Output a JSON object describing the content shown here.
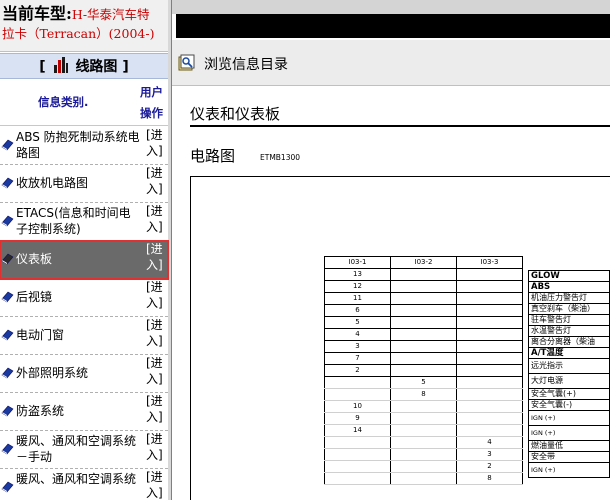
{
  "left_pane": {
    "car_label": "当前车型:",
    "car_model_line1": "H-华泰汽车特",
    "car_model_line2": "拉卡（Terracan）(2004-)",
    "section_title": "线路图",
    "section_bracket_open": "[",
    "section_bracket_close": "]",
    "col_category": "信息类别.",
    "col_ops_line1": "用户",
    "col_ops_line2": "操作",
    "enter_line1": "[进",
    "enter_line2": "入]",
    "items": [
      {
        "name": "ABS 防抱死制动系统电路图",
        "selected": false
      },
      {
        "name": "收放机电路图",
        "selected": false
      },
      {
        "name": "ETACS(信息和时间电子控制系统)",
        "selected": false
      },
      {
        "name": "仪表板",
        "selected": true
      },
      {
        "name": "后视镜",
        "selected": false
      },
      {
        "name": "电动门窗",
        "selected": false
      },
      {
        "name": "外部照明系统",
        "selected": false
      },
      {
        "name": "防盗系统",
        "selected": false
      },
      {
        "name": "暖风、通风和空调系统－手动",
        "selected": false
      },
      {
        "name": "暖风、通风和空调系统",
        "selected": false
      }
    ]
  },
  "right_pane": {
    "toolbar_label": "浏览信息目录",
    "doc_title": "仪表和仪表板",
    "diagram_title": "电路图",
    "diagram_code": "ETMB1300",
    "connectors": {
      "headers": [
        "I03-1",
        "I03-2",
        "I03-3"
      ],
      "rows": [
        [
          "13",
          "",
          ""
        ],
        [
          "12",
          "",
          ""
        ],
        [
          "11",
          "",
          ""
        ],
        [
          "6",
          "",
          ""
        ],
        [
          "5",
          "",
          ""
        ],
        [
          "4",
          "",
          ""
        ],
        [
          "3",
          "",
          ""
        ],
        [
          "7",
          "",
          ""
        ],
        [
          "2",
          "",
          ""
        ],
        [
          "",
          "5",
          ""
        ],
        [
          "",
          "8",
          ""
        ],
        [
          "10",
          "",
          ""
        ],
        [
          "9",
          "",
          ""
        ],
        [
          "14",
          "",
          ""
        ],
        [
          "",
          "",
          "4"
        ],
        [
          "",
          "",
          "3"
        ],
        [
          "",
          "",
          "2"
        ],
        [
          "",
          "",
          "8"
        ]
      ]
    },
    "signals": [
      "GLOW",
      "ABS",
      "机油压力警告灯",
      "真空刹车（柴油）",
      "驻车警告灯",
      "水温警告灯",
      "离合分离器（柴油",
      "A/T温度",
      "远光指示",
      "大灯电源",
      "安全气囊(+)",
      "安全气囊(-)",
      "IGN (+)",
      "IGN (+)",
      "燃油量低",
      "安全带",
      "IGN (+)"
    ]
  },
  "colors": {
    "selected_bg": "#6a6a6a",
    "selected_outline": "#e03030",
    "car_model_text": "#cc0000",
    "section_header_bg": "#d9e2f3",
    "link_blue": "#1a1a99"
  },
  "icons": {
    "category_bullet": "book-icon",
    "section": "bar-chart-icon",
    "toolbar": "browse-catalog-icon"
  }
}
